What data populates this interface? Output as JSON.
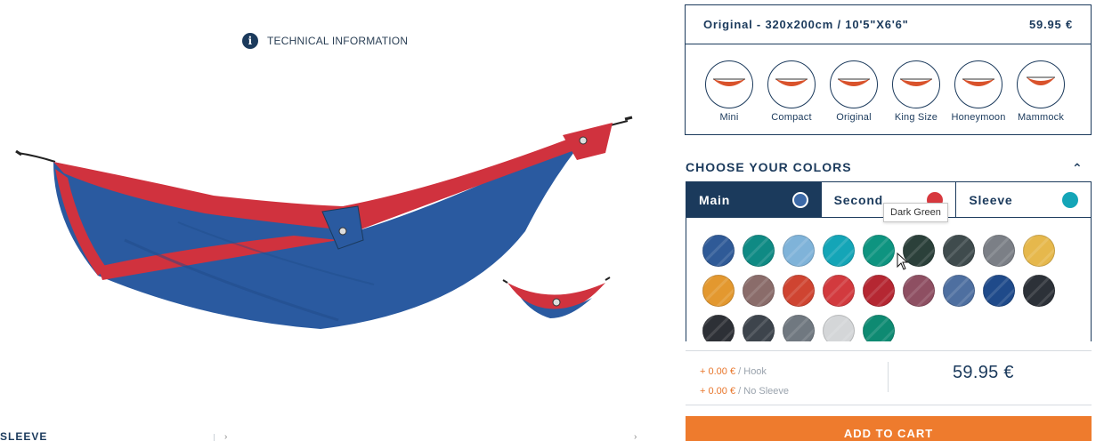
{
  "left": {
    "technical_info_icon": "info-icon",
    "technical_info_label": "TECHNICAL INFORMATION",
    "bottom_label": "SLEEVE"
  },
  "size": {
    "title": "Original - 320x200cm / 10'5\"X6'6\"",
    "price": "59.95 €",
    "options": [
      {
        "label": "Mini"
      },
      {
        "label": "Compact"
      },
      {
        "label": "Original"
      },
      {
        "label": "King Size"
      },
      {
        "label": "Honeymoon"
      },
      {
        "label": "Mammock"
      }
    ]
  },
  "colors": {
    "title": "CHOOSE YOUR COLORS",
    "tabs": [
      {
        "label": "Main",
        "color": "#3d6aa8"
      },
      {
        "label": "Second",
        "color": "#d7383e"
      },
      {
        "label": "Sleeve",
        "color": "#14a5b7"
      }
    ],
    "tooltip": "Dark Green",
    "swatches": [
      "#2f5a97",
      "#0f8a84",
      "#7fb3d9",
      "#14a5b7",
      "#0e9480",
      "#2b403a",
      "#3f4b4d",
      "#7b7f86",
      "#e6b84c",
      "#e3982f",
      "#8a6c6a",
      "#cf4431",
      "#d23a3e",
      "#b52732",
      "#8e4f62",
      "#4e6fa0",
      "#1f4a8a",
      "#2c3138",
      "#2d3036",
      "#3d444c",
      "#707880",
      "#d4d6d8",
      "#0e8a72"
    ]
  },
  "summary": {
    "extras": [
      {
        "price": "+ 0.00 €",
        "sep": " / ",
        "name": "Hook"
      },
      {
        "price": "+ 0.00 €",
        "sep": " / ",
        "name": "No Sleeve"
      }
    ],
    "total": "59.95 €"
  },
  "cart": {
    "label": "ADD TO CART"
  },
  "brand_colors": {
    "navy": "#1b3a5c",
    "orange": "#ee7b2d"
  }
}
